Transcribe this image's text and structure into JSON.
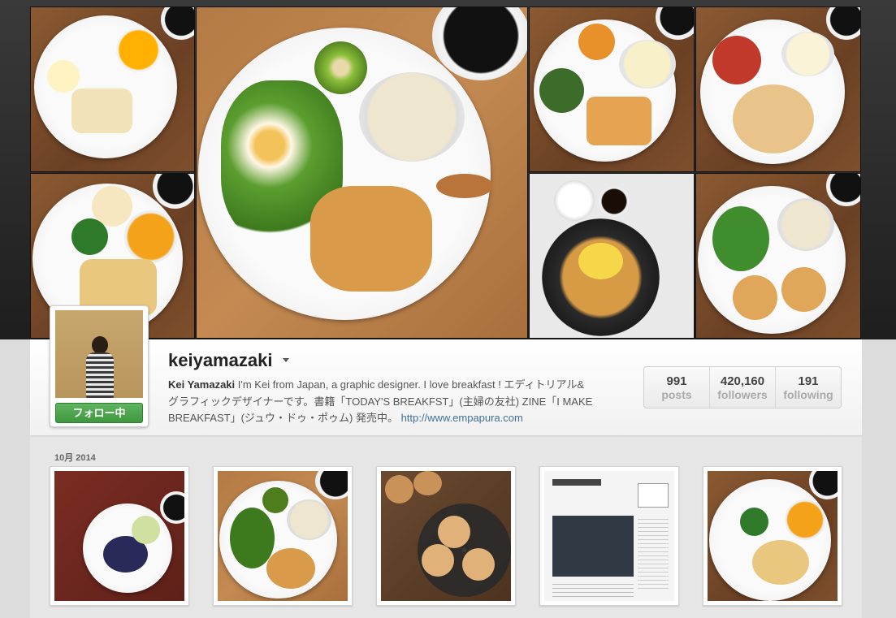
{
  "profile": {
    "username": "keiyamazaki",
    "full_name": "Kei Yamazaki",
    "bio_line1": " I'm Kei from Japan, a graphic designer. I love breakfast ! エディトリアル&",
    "bio_line2": "グラフィックデザイナーです。書籍「TODAY'S BREAKFST」(主婦の友社) ZINE「I MAKE",
    "bio_line3": "BREAKFAST」(ジュウ・ドゥ・ポゥム) 発売中。",
    "website": "http://www.empapura.com",
    "follow_label": "フォロー中"
  },
  "stats": [
    {
      "value": "991",
      "label": "posts"
    },
    {
      "value": "420,160",
      "label": "followers"
    },
    {
      "value": "191",
      "label": "following"
    }
  ],
  "feed": {
    "month_label": "10月 2014"
  },
  "colors": {
    "follow_green": "#4aa54a",
    "link_blue": "#3f729b"
  },
  "icons": {
    "dropdown": "caret-down-icon"
  }
}
